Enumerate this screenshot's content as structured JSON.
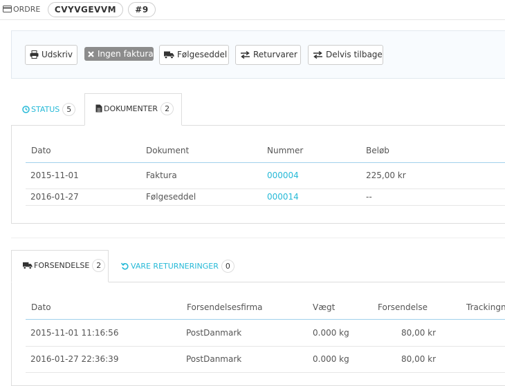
{
  "header": {
    "order_label": "ORDRE",
    "reference": "CVYVGEVVM",
    "order_number": "#9"
  },
  "toolbar": {
    "buttons": [
      {
        "label": "Udskriv",
        "icon": "print-icon"
      },
      {
        "label": "Ingen faktura",
        "icon": "close-icon",
        "disabled": true
      },
      {
        "label": "Følgeseddel",
        "icon": "truck-icon"
      },
      {
        "label": "Returvarer",
        "icon": "exchange-icon"
      },
      {
        "label": "Delvis tilbage",
        "icon": "exchange-icon"
      }
    ]
  },
  "doc_tabs": {
    "status": {
      "label": "STATUS",
      "count": "5"
    },
    "documents": {
      "label": "DOKUMENTER",
      "count": "2"
    }
  },
  "documents_table": {
    "headers": [
      "Dato",
      "Dokument",
      "Nummer",
      "Beløb"
    ],
    "rows": [
      [
        "2015-11-01",
        "Faktura",
        "000004",
        "225,00 kr"
      ],
      [
        "2016-01-27",
        "Følgeseddel",
        "000014",
        "--"
      ]
    ]
  },
  "ship_tabs": {
    "shipping": {
      "label": "FORSENDELSE",
      "count": "2"
    },
    "returns": {
      "label": "VARE RETURNERINGER",
      "count": "0"
    }
  },
  "shipping_table": {
    "headers": [
      "Dato",
      "Forsendelsesfirma",
      "Vægt",
      "Forsendelse",
      "Trackingnu"
    ],
    "rows": [
      [
        "2015-11-01 11:16:56",
        "PostDanmark",
        "0.000 kg",
        "80,00 kr"
      ],
      [
        "2016-01-27 22:36:39",
        "PostDanmark",
        "0.000 kg",
        "80,00 kr"
      ]
    ]
  },
  "colors": {
    "accent": "#25b9d7",
    "disabled_button": "#8c8c8c",
    "text": "#555555"
  }
}
